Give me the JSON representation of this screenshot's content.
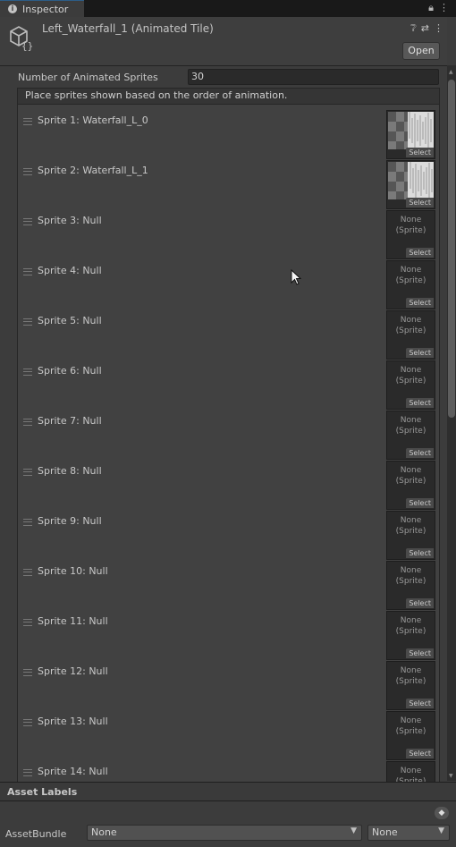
{
  "tab": {
    "icon": "info-icon",
    "title": "Inspector",
    "icons": [
      "lock-icon",
      "more-vert-icon"
    ]
  },
  "header": {
    "icon": "tile-asset-icon",
    "title": "Left_Waterfall_1 (Animated Tile)",
    "icons": [
      "help-icon",
      "preset-icon",
      "more-vert-icon"
    ],
    "open_label": "Open"
  },
  "count": {
    "label": "Number of Animated Sprites",
    "value": "30"
  },
  "list_header": "Place sprites shown based on the order of animation.",
  "slot_select_label": "Select",
  "slot_none_label": "None\n(Sprite)",
  "sprites": [
    {
      "label": "Sprite 1: Waterfall_L_0",
      "has_image": true
    },
    {
      "label": "Sprite 2: Waterfall_L_1",
      "has_image": true
    },
    {
      "label": "Sprite 3: Null",
      "has_image": false
    },
    {
      "label": "Sprite 4: Null",
      "has_image": false
    },
    {
      "label": "Sprite 5: Null",
      "has_image": false
    },
    {
      "label": "Sprite 6: Null",
      "has_image": false
    },
    {
      "label": "Sprite 7: Null",
      "has_image": false
    },
    {
      "label": "Sprite 8: Null",
      "has_image": false
    },
    {
      "label": "Sprite 9: Null",
      "has_image": false
    },
    {
      "label": "Sprite 10: Null",
      "has_image": false
    },
    {
      "label": "Sprite 11: Null",
      "has_image": false
    },
    {
      "label": "Sprite 12: Null",
      "has_image": false
    },
    {
      "label": "Sprite 13: Null",
      "has_image": false
    },
    {
      "label": "Sprite 14: Null",
      "has_image": false
    }
  ],
  "asset_labels": {
    "title": "Asset Labels",
    "tag_icon": "tag-icon"
  },
  "asset_bundle": {
    "label": "AssetBundle",
    "name_value": "None",
    "variant_value": "None"
  },
  "colors": {
    "panel": "#3c3c3c",
    "list_bg": "#414141",
    "tab_bar": "#191919",
    "accent": "#2c5d87"
  }
}
